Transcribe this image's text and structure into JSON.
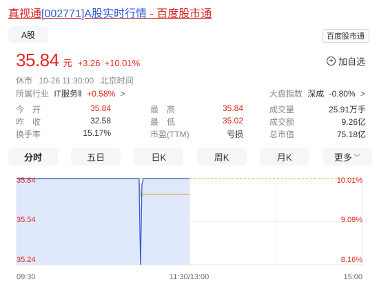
{
  "page_title": {
    "name_link": "真视通",
    "code_link": "[002771]A股实时行情",
    "separator": " - ",
    "site_link": "百度股市通"
  },
  "market_tab": "A股",
  "brand_badge": "百度股市通",
  "quote": {
    "price": "35.84",
    "unit": "元",
    "change": "+3.26",
    "change_pct": "+10.01%"
  },
  "add_watch_label": "加自选",
  "status": {
    "state": "休市",
    "time": "10-26 11:30:00",
    "zone": "北京时间"
  },
  "industry": {
    "label": "所属行业",
    "name": "IT服务Ⅱ",
    "pct": "+0.58%",
    "chevron": ">"
  },
  "market_index": {
    "label": "大盘指数",
    "name": "深成",
    "pct": "-0.80%",
    "chevron": ">"
  },
  "stats": [
    [
      {
        "label": "今　开",
        "value": "35.84",
        "tone": "red"
      },
      {
        "label": "最　高",
        "value": "35.84",
        "tone": "red"
      },
      {
        "label": "成交量",
        "value": "25.91万手",
        "tone": "dark"
      }
    ],
    [
      {
        "label": "昨　收",
        "value": "32.58",
        "tone": "dark"
      },
      {
        "label": "最　低",
        "value": "35.02",
        "tone": "red"
      },
      {
        "label": "成交额",
        "value": "9.26亿",
        "tone": "dark"
      }
    ],
    [
      {
        "label": "换手率",
        "value": "15.17%",
        "tone": "dark"
      },
      {
        "label": "市盈(TTM)",
        "value": "亏损",
        "tone": "dark"
      },
      {
        "label": "总市值",
        "value": "75.18亿",
        "tone": "dark"
      }
    ]
  ],
  "chart_tabs": [
    {
      "label": "分时",
      "active": true
    },
    {
      "label": "五日",
      "active": false
    },
    {
      "label": "日K",
      "active": false
    },
    {
      "label": "周K",
      "active": false
    },
    {
      "label": "月K",
      "active": false
    },
    {
      "label": "更多",
      "active": false,
      "dropdown": true
    }
  ],
  "chart_data": {
    "type": "line",
    "y_ticks": [
      "35.84",
      "35.54",
      "35.24"
    ],
    "y_right_ticks": [
      "10.01%",
      "9.09%",
      "8.16%"
    ],
    "x_ticks": [
      "09:30",
      "11:30/13:00",
      "15:00"
    ],
    "ylim": [
      35.24,
      35.84
    ],
    "grid": true,
    "series": [
      {
        "color": "#2f5bd8",
        "x": [
          "09:30",
          "10:00",
          "10:55",
          "10:56",
          "10:57",
          "10:58",
          "11:30"
        ],
        "values": [
          35.84,
          35.84,
          35.84,
          35.24,
          35.8,
          35.84,
          35.84
        ]
      },
      {
        "color": "#f0a030",
        "x": [
          "09:30",
          "10:00",
          "10:55",
          "10:56",
          "10:58",
          "11:05",
          "11:30"
        ],
        "values": [
          35.84,
          35.84,
          35.84,
          35.72,
          35.73,
          35.73,
          35.73
        ]
      }
    ]
  },
  "colors": {
    "up": "#e1261c",
    "price_line": "#2f5bd8",
    "avg_line": "#f0a030",
    "fill": "#dde6fb"
  }
}
